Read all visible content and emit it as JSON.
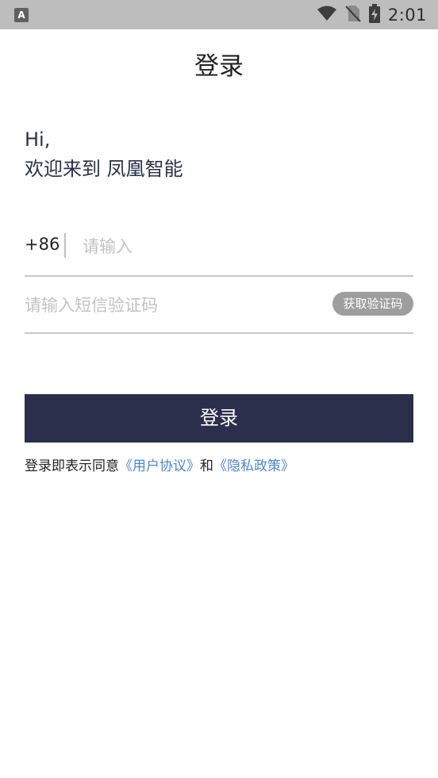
{
  "status_bar": {
    "app_icon_letter": "A",
    "time": "2:01"
  },
  "page": {
    "title": "登录",
    "greeting_line1": "Hi,",
    "greeting_line2": "欢迎来到 凤凰智能"
  },
  "form": {
    "country_code": "+86",
    "phone_placeholder": "请输入",
    "code_placeholder": "请输入短信验证码",
    "get_code_label": "获取验证码",
    "login_label": "登录"
  },
  "agreement": {
    "prefix": "登录即表示同意",
    "user_agreement": "《用户协议》",
    "conjunction": "和",
    "privacy_policy": "《隐私政策》"
  },
  "colors": {
    "primary_button": "#2b2f4b",
    "link": "#4a86d8",
    "get_code_button": "#9e9e9e",
    "status_bar": "#bdbdbd"
  }
}
